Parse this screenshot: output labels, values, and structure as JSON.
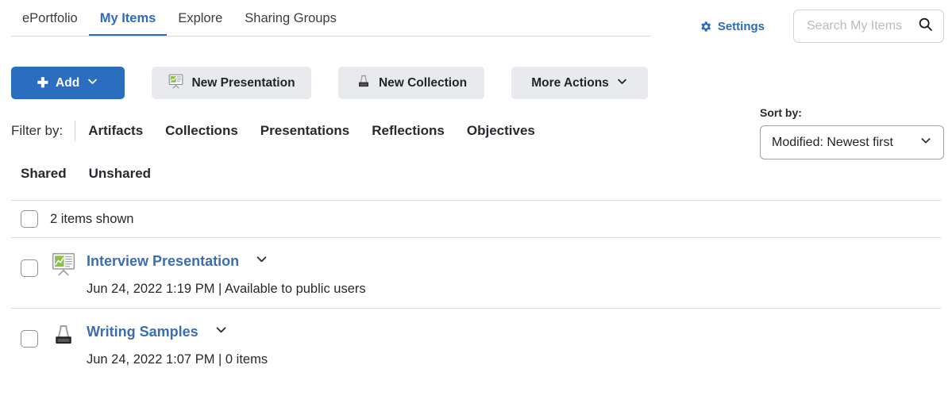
{
  "nav": {
    "tabs": [
      {
        "label": "ePortfolio",
        "active": false
      },
      {
        "label": "My Items",
        "active": true
      },
      {
        "label": "Explore",
        "active": false
      },
      {
        "label": "Sharing Groups",
        "active": false
      }
    ]
  },
  "header": {
    "settings_label": "Settings",
    "settings_icon": "gear-icon",
    "accent_color": "#2f6cb5"
  },
  "search": {
    "placeholder": "Search My Items",
    "value": "",
    "icon": "search-icon"
  },
  "toolbar": {
    "add_label": "Add",
    "add_icon": "plus-icon",
    "add_chevron": "chevron-down-icon",
    "new_presentation_label": "New Presentation",
    "new_presentation_icon": "presentation-easel-icon",
    "new_collection_label": "New Collection",
    "new_collection_icon": "binder-clip-icon",
    "more_actions_label": "More Actions",
    "more_actions_chevron": "chevron-down-icon",
    "primary_color": "#2b6dbe",
    "secondary_color": "#e8eaed"
  },
  "filter": {
    "label": "Filter by:",
    "items": [
      {
        "label": "Artifacts"
      },
      {
        "label": "Collections"
      },
      {
        "label": "Presentations"
      },
      {
        "label": "Reflections"
      },
      {
        "label": "Objectives"
      }
    ]
  },
  "sort": {
    "label": "Sort by:",
    "selected": "Modified: Newest first",
    "chevron": "chevron-down-icon"
  },
  "share_filter": {
    "items": [
      {
        "label": "Shared"
      },
      {
        "label": "Unshared"
      }
    ]
  },
  "list": {
    "count_label": "2 items shown",
    "items": [
      {
        "title": "Interview Presentation",
        "icon": "presentation-easel-icon",
        "meta": "Jun 24, 2022 1:19 PM | Available to public users",
        "chevron": "chevron-down-icon"
      },
      {
        "title": "Writing Samples",
        "icon": "binder-clip-icon",
        "meta": "Jun 24, 2022 1:07 PM | 0 items",
        "chevron": "chevron-down-icon"
      }
    ]
  }
}
